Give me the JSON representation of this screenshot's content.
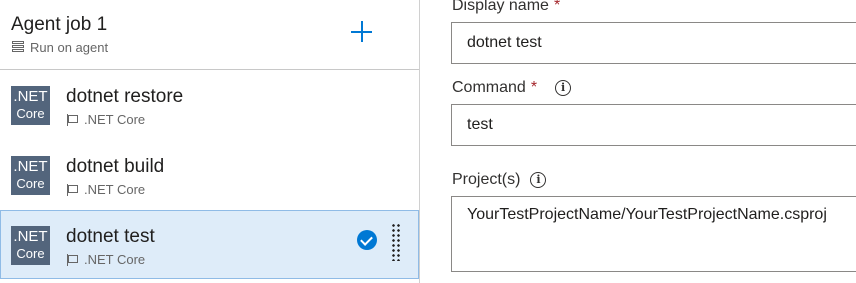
{
  "agent_job": {
    "title": "Agent job 1",
    "subtitle": "Run on agent",
    "add_icon": "plus-icon"
  },
  "tasks": [
    {
      "name": "dotnet restore",
      "subtitle": ".NET Core",
      "logo_line1": ".NET",
      "logo_line2": "Core",
      "selected": false
    },
    {
      "name": "dotnet build",
      "subtitle": ".NET Core",
      "logo_line1": ".NET",
      "logo_line2": "Core",
      "selected": false
    },
    {
      "name": "dotnet test",
      "subtitle": ".NET Core",
      "logo_line1": ".NET",
      "logo_line2": "Core",
      "selected": true
    }
  ],
  "form": {
    "display_name": {
      "label": "Display name",
      "required_mark": "*",
      "value": "dotnet test"
    },
    "command": {
      "label": "Command",
      "required_mark": "*",
      "info_glyph": "i",
      "value": "test"
    },
    "projects": {
      "label": "Project(s)",
      "info_glyph": "i",
      "value": "YourTestProjectName/YourTestProjectName.csproj"
    }
  },
  "colors": {
    "accent": "#0078d4",
    "selected_bg": "#deecf9",
    "logo_bg": "#53657c",
    "required": "#a4262c"
  }
}
